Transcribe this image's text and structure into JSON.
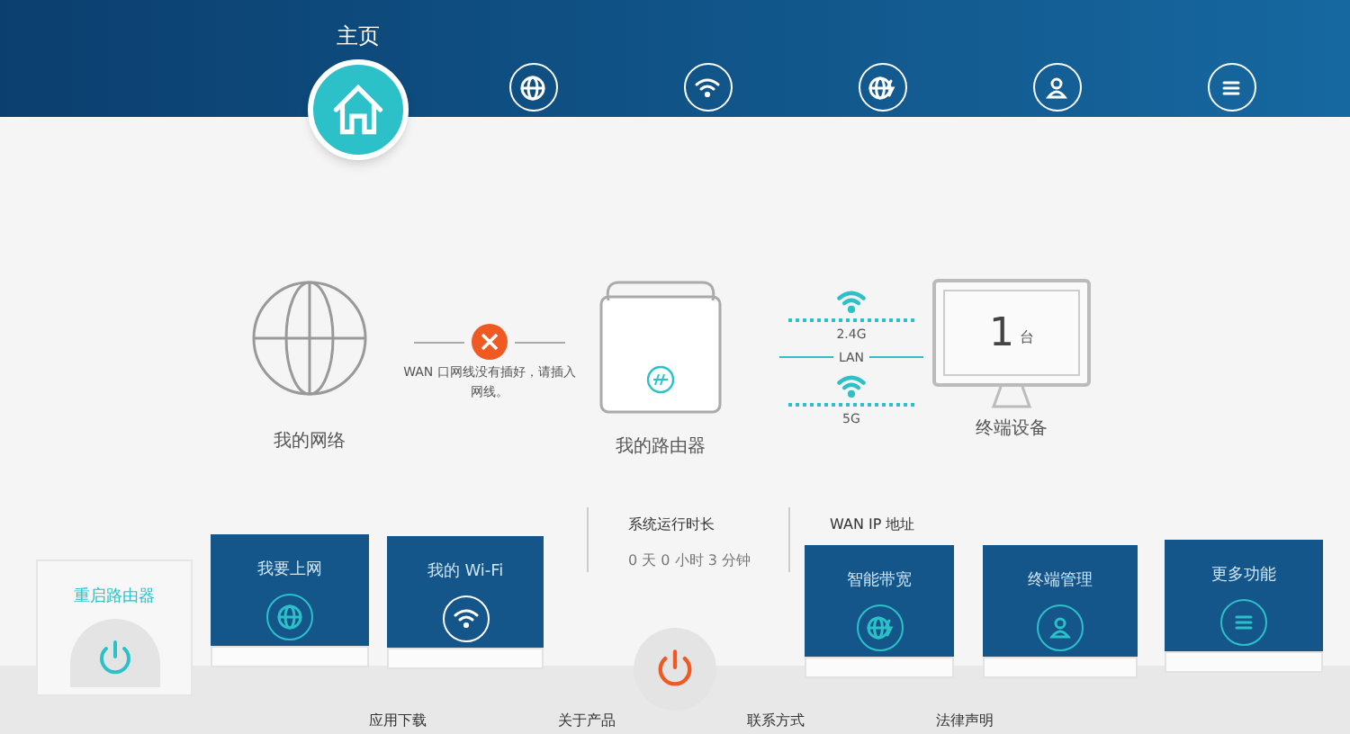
{
  "nav": [
    {
      "label": "主页",
      "kind": "home",
      "selected": true
    },
    {
      "kind": "globe",
      "selected": false
    },
    {
      "kind": "wifi",
      "selected": false
    },
    {
      "kind": "globe-bolt",
      "selected": false
    },
    {
      "kind": "user",
      "selected": false
    },
    {
      "kind": "menu",
      "selected": false
    }
  ],
  "topology": {
    "network_label": "我的网络",
    "wan_error": "WAN 口网线没有插好，请插入网线。",
    "router_label": "我的路由器",
    "band_24": "2.4G",
    "lan": "LAN",
    "band_5": "5G",
    "device_count": "1",
    "device_unit": "台",
    "devices_label": "终端设备"
  },
  "stats": [
    {
      "label": "系统运行时长",
      "value": "0 天 0 小时 3 分钟"
    },
    {
      "label": "WAN IP 地址"
    }
  ],
  "restart": {
    "label": "重启路由器"
  },
  "tiles": [
    {
      "label": "我要上网",
      "kind": "globe"
    },
    {
      "label": "我的 Wi-Fi",
      "kind": "wifi"
    },
    {
      "label": "智能带宽",
      "kind": "globe-bolt"
    },
    {
      "label": "终端管理",
      "kind": "user"
    },
    {
      "label": "更多功能",
      "kind": "menu"
    }
  ],
  "footer_links": [
    "应用下载",
    "关于产品",
    "联系方式",
    "法律声明"
  ]
}
